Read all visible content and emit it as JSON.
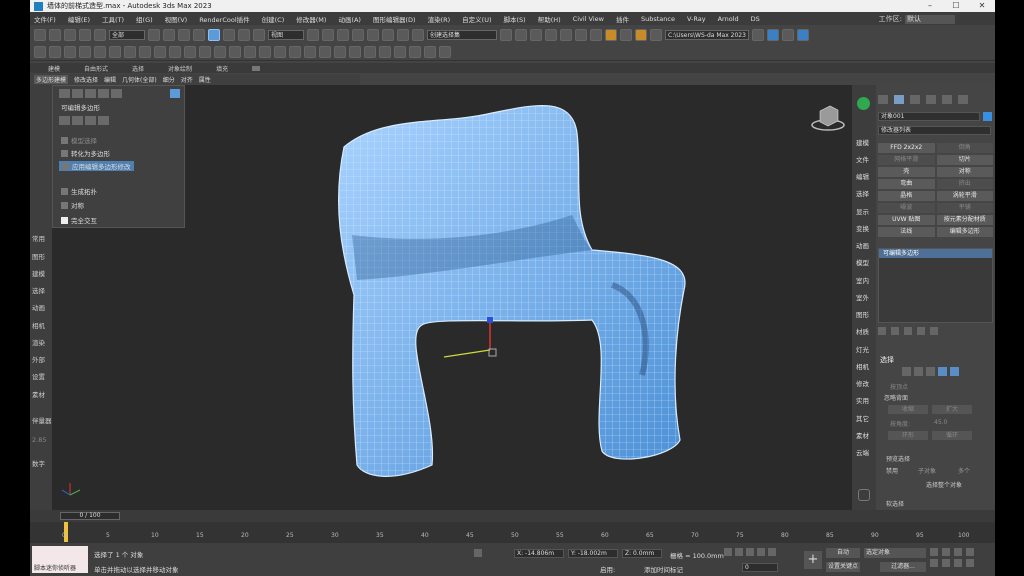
{
  "window": {
    "title": "墙体的前梯式造型.max - Autodesk 3ds Max 2023",
    "buttons": [
      "–",
      "☐",
      "✕"
    ]
  },
  "menu": {
    "items": [
      "文件(F)",
      "编辑(E)",
      "工具(T)",
      "组(G)",
      "视图(V)",
      "RenderCool插件",
      "创建(C)",
      "修改器(M)",
      "动画(A)",
      "图形编辑器(D)",
      "渲染(R)",
      "自定义(U)",
      "脚本(S)",
      "帮助(H)",
      "Civil View",
      "插件",
      "Substance",
      "V-Ray",
      "Arnold",
      "DS"
    ],
    "workspace_label": "工作区:",
    "workspace_value": "默认"
  },
  "toolbar": {
    "filter_select": "全部",
    "view_select": "视图",
    "named_selection": "创建选择集",
    "path": "C:\\Users\\WS-da Max 2023"
  },
  "ribbon": {
    "tabs": [
      "建模",
      "自由形式",
      "选择",
      "对象绘制",
      "填充"
    ],
    "subtabs": [
      "多边形建模",
      "修改选择",
      "编辑",
      "几何体(全部)",
      "细分",
      "对齐",
      "属性"
    ]
  },
  "left_bar": {
    "items": [
      "常用",
      "图形",
      "建模",
      "选择",
      "动画",
      "相机",
      "渲染",
      "外部",
      "设置",
      "素材",
      "伴量器",
      "2.85",
      "数字"
    ]
  },
  "flyout": {
    "title": "可编辑多边形",
    "rows": [
      "模型选择",
      "转化为多边形",
      "应用编辑多边形修改",
      "生成拓扑",
      "对称",
      "完全交互"
    ]
  },
  "command_panel": {
    "side_items": [
      "建模",
      "文件",
      "编辑",
      "选择",
      "显示",
      "变换",
      "动画",
      "模型",
      "室内",
      "室外",
      "图形",
      "材质",
      "灯光",
      "相机",
      "修改",
      "实用",
      "其它",
      "素材",
      "云端"
    ],
    "object_name": "对象001",
    "modifier_list": "修改器列表",
    "modifiers": [
      "FFD 2x2x2",
      "倒角",
      "网格平滑",
      "切片",
      "壳",
      "对称",
      "弯曲",
      "挤出",
      "晶格",
      "涡轮平滑",
      "噪波",
      "平铺",
      "UVW 贴图",
      "按元素分配材质",
      "法线",
      "编辑多边形"
    ],
    "modifiers_dim": [
      false,
      true,
      true,
      false,
      false,
      false,
      false,
      true,
      false,
      false,
      true,
      true,
      false,
      false,
      false,
      false
    ],
    "stack_item": "可编辑多边形",
    "selection": {
      "title": "选择",
      "by_vertex": "按顶点",
      "ignore_back": "忽略背面",
      "by_angle": "按角度:",
      "angle_value": "45.0",
      "shrink": "收缩",
      "grow": "扩大",
      "ring": "环形",
      "loop": "循环",
      "preview_title": "预览选择",
      "preview_off": "禁用",
      "preview_sub": "子对象",
      "preview_multi": "多个",
      "whole_object": "选择整个对象",
      "soft_sel": "软选择"
    }
  },
  "timeline": {
    "frame_display": "0 / 100",
    "ticks": [
      "0",
      "5",
      "10",
      "15",
      "20",
      "25",
      "30",
      "35",
      "40",
      "45",
      "50",
      "55",
      "60",
      "65",
      "70",
      "75",
      "80",
      "85",
      "90",
      "95",
      "100"
    ]
  },
  "status": {
    "maxscript_label": "脚本迷你侦听器",
    "selected_text": "选择了 1 个 对象",
    "hint_text": "单击并拖动以选择并移动对象",
    "x_value": "X: -14.806m",
    "y_value": "Y: -18.002m",
    "z_value": "Z: 0.0mm",
    "grid_value": "栅格 = 100.0mm",
    "enabled_label": "启用:",
    "add_time_tag": "添加时间标记",
    "auto_key": "自动",
    "selected_obj": "选定对象",
    "set_key": "设置关键点",
    "filters": "过滤器...",
    "frame_num": "0"
  }
}
